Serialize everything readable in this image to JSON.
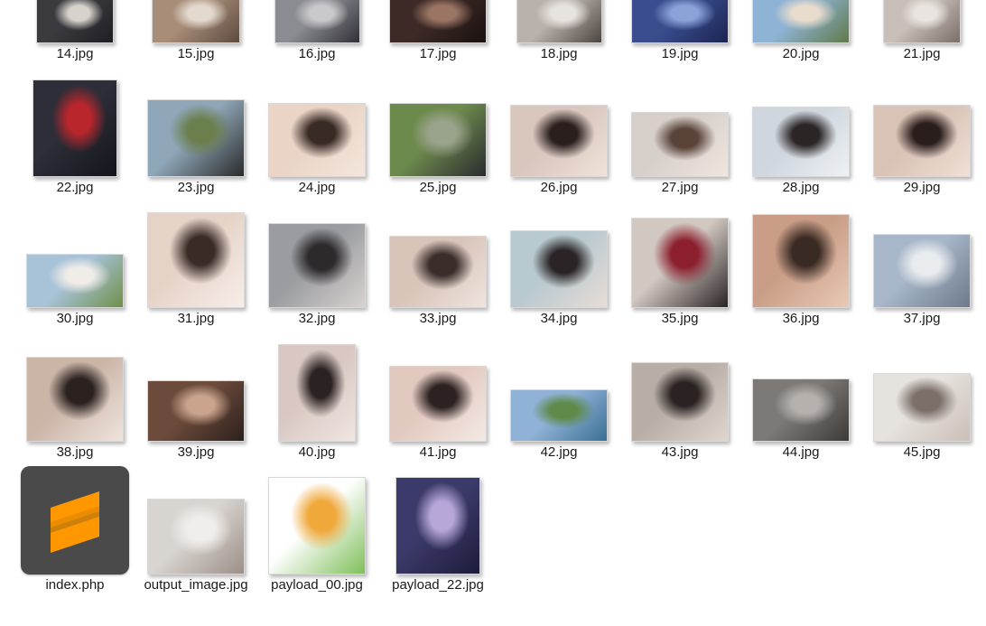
{
  "files": [
    {
      "name": "14.jpg",
      "kind": "image",
      "colors": [
        "#3a3a3f",
        "#d8d2cc",
        "#1e1e24"
      ]
    },
    {
      "name": "15.jpg",
      "kind": "image",
      "colors": [
        "#a88d78",
        "#e3d9cf",
        "#5d4a40"
      ]
    },
    {
      "name": "16.jpg",
      "kind": "image",
      "colors": [
        "#8b8b92",
        "#c9c9cc",
        "#303036"
      ]
    },
    {
      "name": "17.jpg",
      "kind": "image",
      "colors": [
        "#3d2a26",
        "#9a7564",
        "#1a1110"
      ]
    },
    {
      "name": "18.jpg",
      "kind": "image",
      "colors": [
        "#b9b2ac",
        "#e7e3de",
        "#4b4440"
      ]
    },
    {
      "name": "19.jpg",
      "kind": "image",
      "colors": [
        "#3a4e8f",
        "#8aa3d9",
        "#1c2451"
      ]
    },
    {
      "name": "20.jpg",
      "kind": "image",
      "colors": [
        "#8fb3d4",
        "#e8dccd",
        "#5f7a4a"
      ]
    },
    {
      "name": "21.jpg",
      "kind": "image",
      "colors": [
        "#c8bfb8",
        "#e9e4df",
        "#7a6e68"
      ]
    },
    {
      "name": "22.jpg",
      "kind": "image",
      "colors": [
        "#2d2e38",
        "#b9262c",
        "#14151b"
      ]
    },
    {
      "name": "23.jpg",
      "kind": "image",
      "colors": [
        "#8fa7b8",
        "#6b7f4e",
        "#2a2a2a"
      ]
    },
    {
      "name": "24.jpg",
      "kind": "image",
      "colors": [
        "#e9d4c6",
        "#3a2a25",
        "#f4e6dc"
      ]
    },
    {
      "name": "25.jpg",
      "kind": "image",
      "colors": [
        "#6d8a4d",
        "#9aa38b",
        "#2b2b30"
      ]
    },
    {
      "name": "26.jpg",
      "kind": "image",
      "colors": [
        "#d9c6bd",
        "#2a1f1d",
        "#efe2da"
      ]
    },
    {
      "name": "27.jpg",
      "kind": "image",
      "colors": [
        "#d7d0ca",
        "#5a443a",
        "#efe6df"
      ]
    },
    {
      "name": "28.jpg",
      "kind": "image",
      "colors": [
        "#cfd6de",
        "#2b2526",
        "#eef1f4"
      ]
    },
    {
      "name": "29.jpg",
      "kind": "image",
      "colors": [
        "#d9c2b6",
        "#2a1e1c",
        "#f0e0d6"
      ]
    },
    {
      "name": "30.jpg",
      "kind": "image",
      "colors": [
        "#a8c3d8",
        "#f0ede8",
        "#6f8f4a"
      ]
    },
    {
      "name": "31.jpg",
      "kind": "image",
      "colors": [
        "#e6d3c8",
        "#3a2b27",
        "#f7eee8"
      ]
    },
    {
      "name": "32.jpg",
      "kind": "image",
      "colors": [
        "#9a9ca1",
        "#2d2a2b",
        "#d8d2ce"
      ]
    },
    {
      "name": "33.jpg",
      "kind": "image",
      "colors": [
        "#d8c4b9",
        "#3a2d2a",
        "#efe4dd"
      ]
    },
    {
      "name": "34.jpg",
      "kind": "image",
      "colors": [
        "#b8c9cf",
        "#2a2426",
        "#e7ddd6"
      ]
    },
    {
      "name": "35.jpg",
      "kind": "image",
      "colors": [
        "#d2c8c2",
        "#8c1f2e",
        "#2a2424"
      ]
    },
    {
      "name": "36.jpg",
      "kind": "image",
      "colors": [
        "#c99d86",
        "#3a2a24",
        "#e8c9b6"
      ]
    },
    {
      "name": "37.jpg",
      "kind": "image",
      "colors": [
        "#a7b6c8",
        "#e9ecef",
        "#6c7a8b"
      ]
    },
    {
      "name": "38.jpg",
      "kind": "image",
      "colors": [
        "#cbb5a7",
        "#2b2220",
        "#efe4dd"
      ]
    },
    {
      "name": "39.jpg",
      "kind": "image",
      "colors": [
        "#6d4b3c",
        "#caa48d",
        "#2b201c"
      ]
    },
    {
      "name": "40.jpg",
      "kind": "image",
      "colors": [
        "#d9c7c1",
        "#2b2323",
        "#f0e6e2"
      ]
    },
    {
      "name": "41.jpg",
      "kind": "image",
      "colors": [
        "#e2c9c0",
        "#2d2222",
        "#f4e9e4"
      ]
    },
    {
      "name": "42.jpg",
      "kind": "image",
      "colors": [
        "#8fb2d6",
        "#5f8a4a",
        "#3b6f94"
      ]
    },
    {
      "name": "43.jpg",
      "kind": "image",
      "colors": [
        "#b9aea6",
        "#2a2322",
        "#e1d6cd"
      ]
    },
    {
      "name": "44.jpg",
      "kind": "image",
      "colors": [
        "#7c7977",
        "#b6b1ad",
        "#3d3a38"
      ]
    },
    {
      "name": "45.jpg",
      "kind": "image",
      "colors": [
        "#e6e2de",
        "#7b6f68",
        "#cbbfb7"
      ]
    },
    {
      "name": "index.php",
      "kind": "sublime",
      "colors": [
        "#4a4a4a",
        "#ff9800",
        "#3c3c3c"
      ]
    },
    {
      "name": "output_image.jpg",
      "kind": "image",
      "colors": [
        "#d8d4d0",
        "#f0eeec",
        "#9c8f88"
      ]
    },
    {
      "name": "payload_00.jpg",
      "kind": "image",
      "colors": [
        "#ffffff",
        "#f0a83a",
        "#7fbf5a"
      ]
    },
    {
      "name": "payload_22.jpg",
      "kind": "image",
      "colors": [
        "#3c3a6a",
        "#b7a7d8",
        "#1e1c3a"
      ]
    }
  ]
}
